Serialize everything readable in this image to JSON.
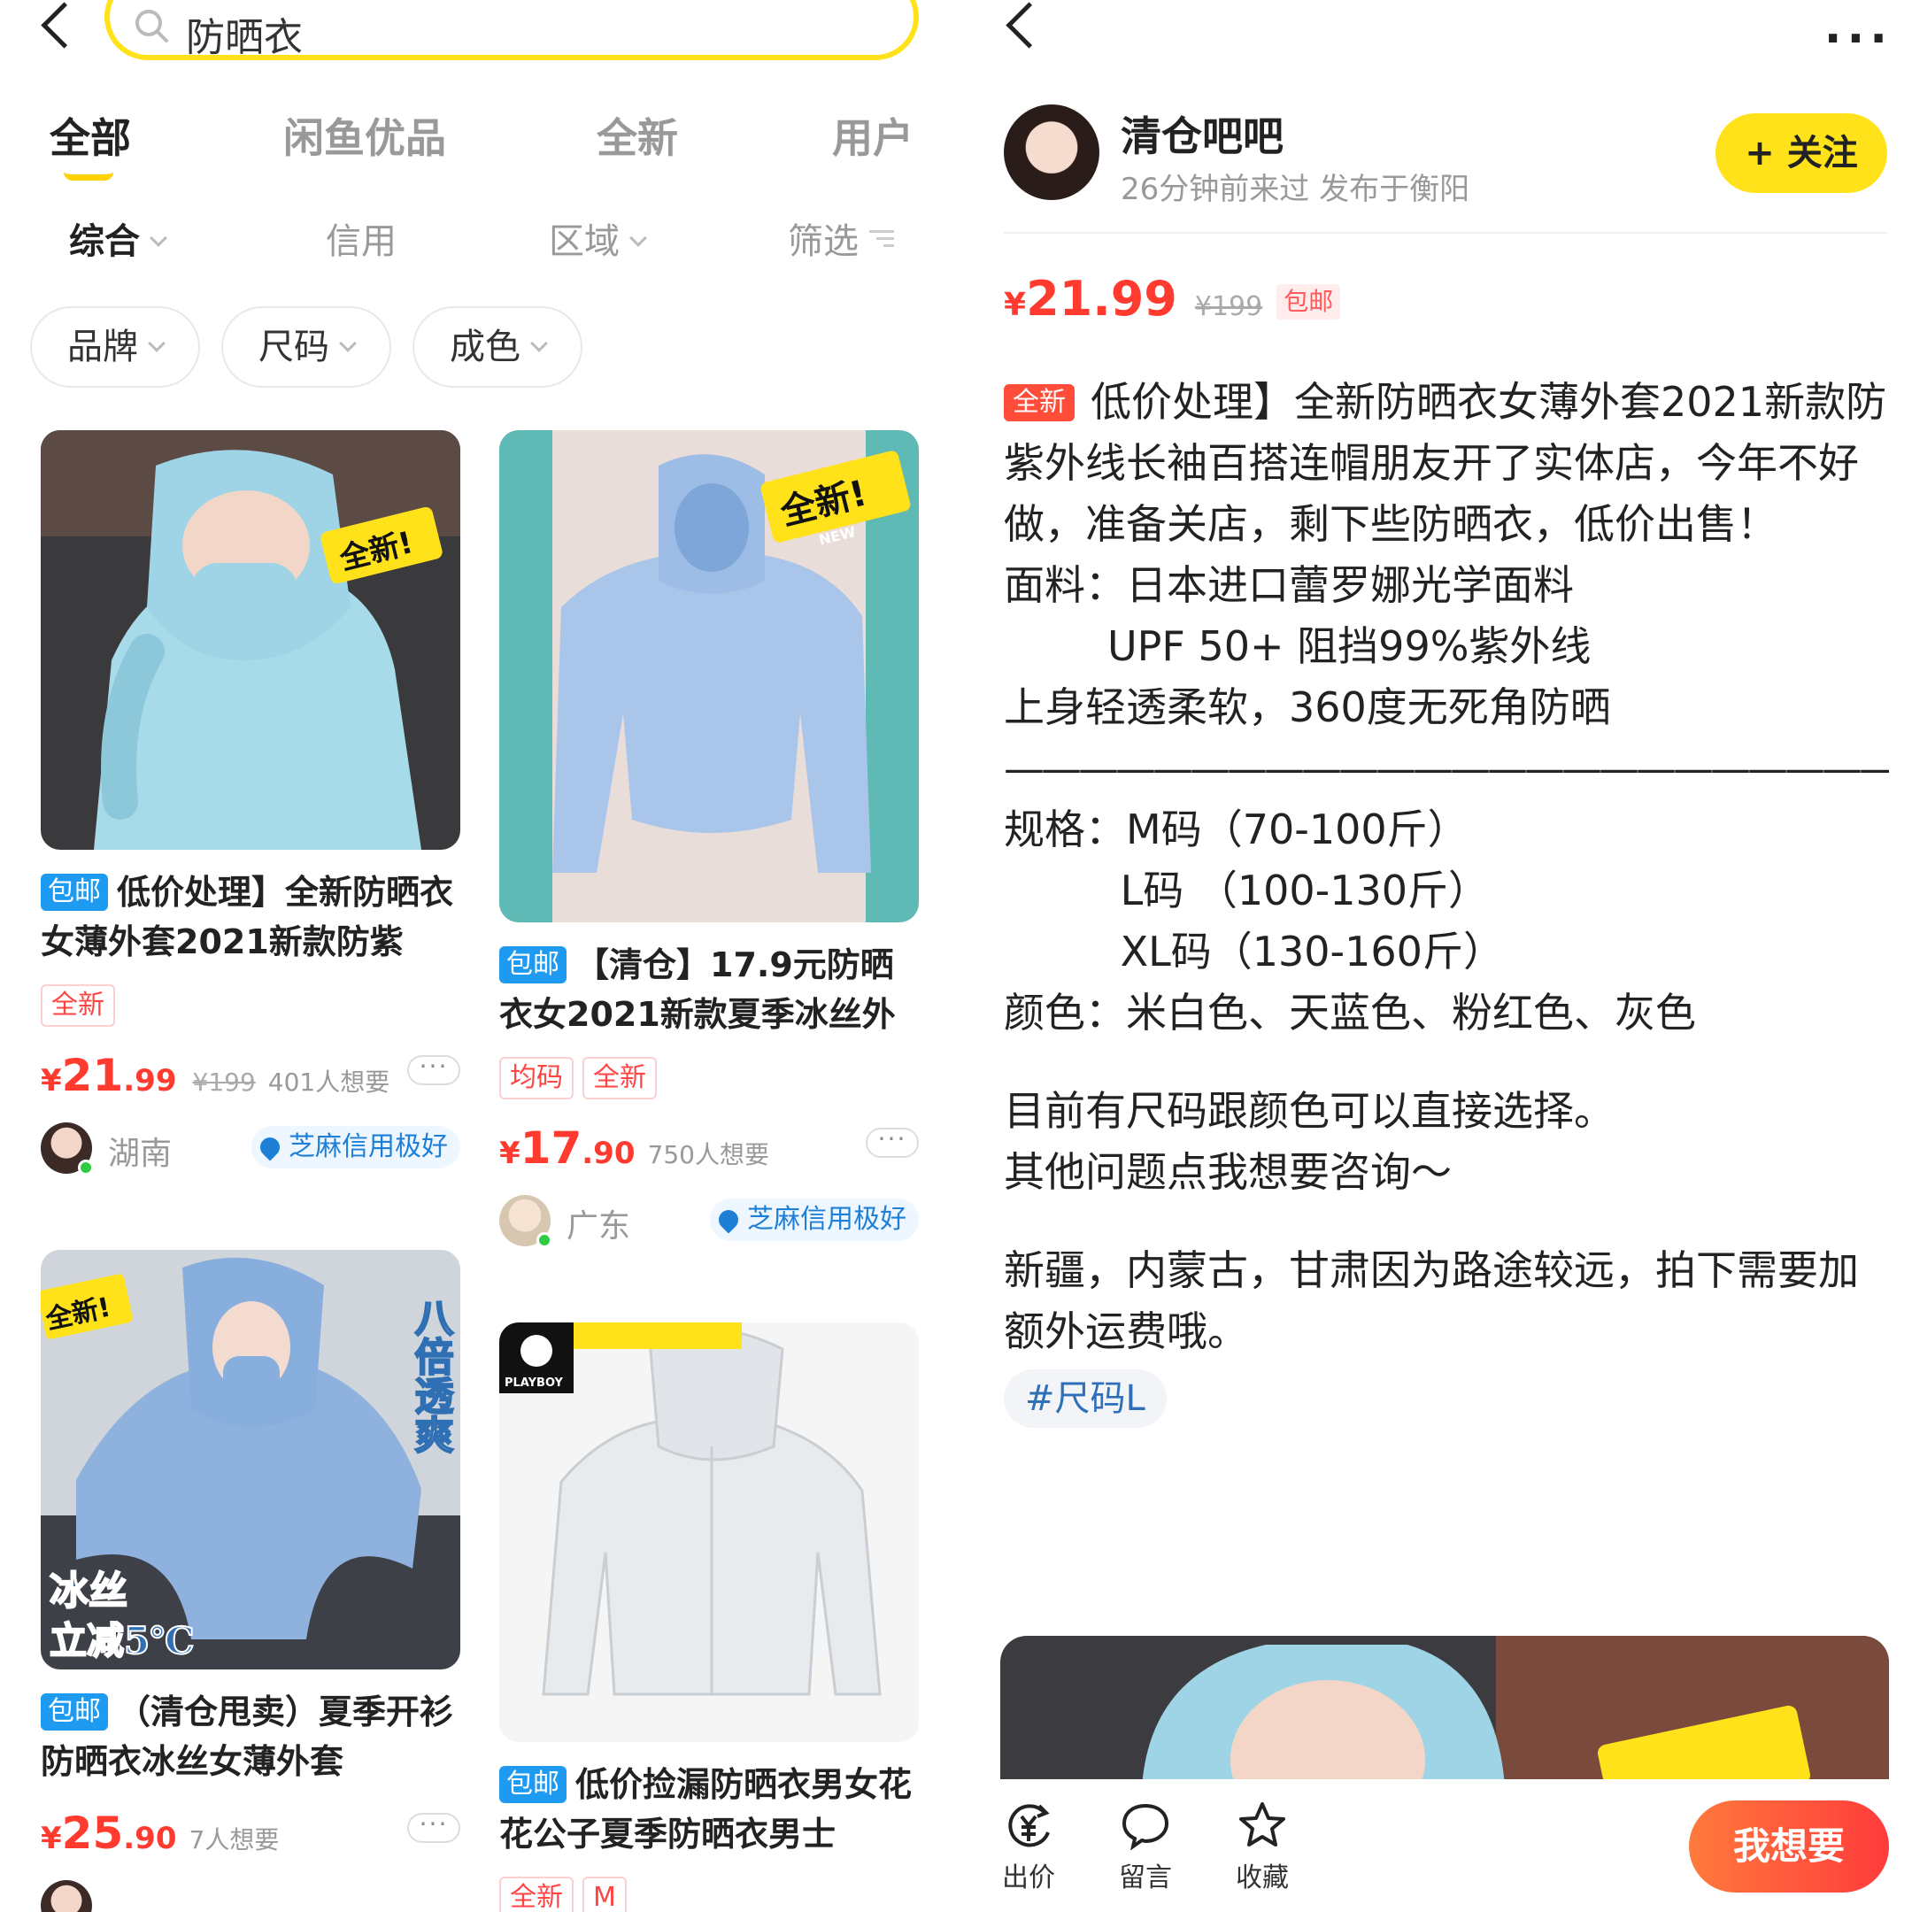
{
  "left": {
    "search": {
      "query": "防晒衣"
    },
    "tabs": [
      "全部",
      "闲鱼优品",
      "全新",
      "用户"
    ],
    "sort": {
      "comprehensive": "综合",
      "credit": "信用",
      "region": "区域",
      "filter": "筛选"
    },
    "chips": [
      "品牌",
      "尺码",
      "成色"
    ],
    "cards": [
      {
        "badge": "包邮",
        "title": "低价处理】全新防晒衣女薄外套2021新款防紫",
        "tags": [
          "全新"
        ],
        "yen": "¥",
        "price_int": "21",
        "price_dec": ".99",
        "old_price": "¥199",
        "want": "401人想要",
        "region": "湖南",
        "credit": "芝麻信用极好"
      },
      {
        "badge": "包邮",
        "title": "【清仓】17.9元防晒衣女2021新款夏季冰丝外",
        "tags": [
          "均码",
          "全新"
        ],
        "yen": "¥",
        "price_int": "17",
        "price_dec": ".90",
        "want": "750人想要",
        "region": "广东",
        "credit": "芝麻信用极好"
      },
      {
        "badge": "包邮",
        "title": "（清仓甩卖）夏季开衫防晒衣冰丝女薄外套",
        "yen": "¥",
        "price_int": "25",
        "price_dec": ".90",
        "want": "7人想要"
      },
      {
        "badge": "包邮",
        "title": "低价捡漏防晒衣男女花花公子夏季防晒衣男士",
        "tags": [
          "全新",
          "M"
        ]
      }
    ],
    "image_text": {
      "new_sticker": "全新!",
      "new_small": "NEW",
      "side_text": "八倍透爽",
      "ice_silk": "冰丝",
      "cool": "立减5℃",
      "brand": "PLAYBOY"
    }
  },
  "right": {
    "more": "···",
    "seller": {
      "name": "清仓吧吧",
      "meta": "26分钟前来过 发布于衡阳"
    },
    "follow": "+ 关注",
    "price": {
      "yen": "¥",
      "value": "21.99",
      "old": "¥199",
      "free_shipping": "包邮"
    },
    "desc": {
      "badge": "全新",
      "lines": [
        "低价处理】全新防晒衣女薄外套2021新款防紫外线长袖百搭连帽朋友开了实体店，今年不好做，准备关店，剩下些防晒衣，低价出售！",
        "面料：日本进口蕾罗娜光学面料",
        "        UPF 50+ 阻挡99%紫外线",
        "上身轻透柔软，360度无死角防晒",
        "——————————————————————————",
        "规格：M码（70-100斤）",
        "         L码 （100-130斤）",
        "         XL码（130-160斤）",
        "颜色：米白色、天蓝色、粉红色、灰色"
      ],
      "para2": [
        "目前有尺码跟颜色可以直接选择。",
        "其他问题点我想要咨询～"
      ],
      "para3": "新疆，内蒙古，甘肃因为路途较远，拍下需要加额外运费哦。",
      "hashtag": "#尺码L"
    },
    "bottom": {
      "offer": "出价",
      "comment": "留言",
      "favorite": "收藏",
      "want": "我想要"
    }
  },
  "colors": {
    "accent": "#ffe21a",
    "price": "#ff3b30",
    "free_badge": "#1e9bf0"
  }
}
